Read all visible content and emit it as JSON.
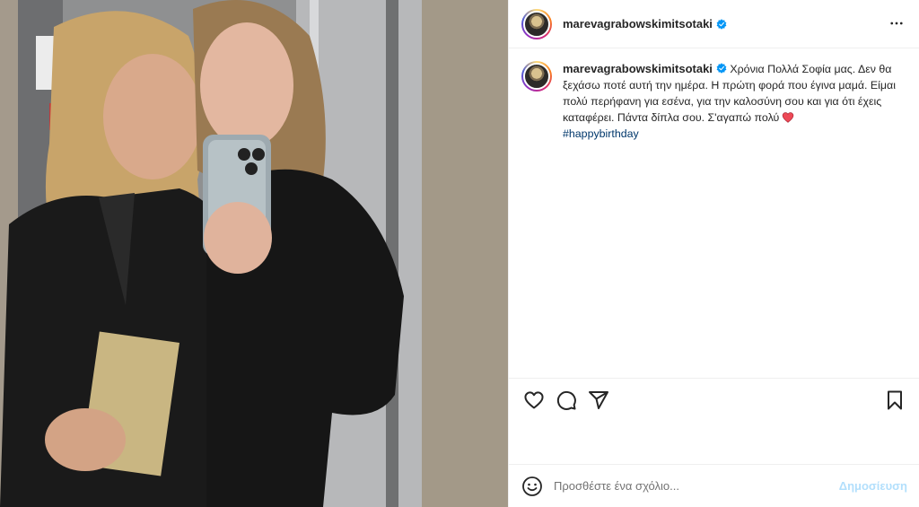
{
  "header": {
    "username": "marevagrabowskimitsotaki",
    "verified_icon": "verified-badge-icon",
    "more_icon": "more-options-icon"
  },
  "caption": {
    "username": "marevagrabowskimitsotaki",
    "text": "Χρόνια Πολλά Σοφία μας. Δεν θα ξεχάσω ποτέ αυτή την ημέρα. Η πρώτη φορά που έγινα μαμά. Είμαι πολύ περήφανη για εσένα, για την καλοσύνη σου και για ότι έχεις καταφέρει. Πάντα δίπλα σου. Σ'αγαπώ πολύ",
    "hashtag": "#happybirthday"
  },
  "actions": {
    "like_icon": "heart-icon",
    "comment_icon": "comment-icon",
    "share_icon": "share-icon",
    "save_icon": "bookmark-icon"
  },
  "comment": {
    "placeholder": "Προσθέστε ένα σχόλιο...",
    "post_label": "Δημοσίευση"
  },
  "colors": {
    "link": "#00376b",
    "verified": "#0095f6",
    "post_disabled": "#b2dffc",
    "heart": "#ed4956"
  }
}
